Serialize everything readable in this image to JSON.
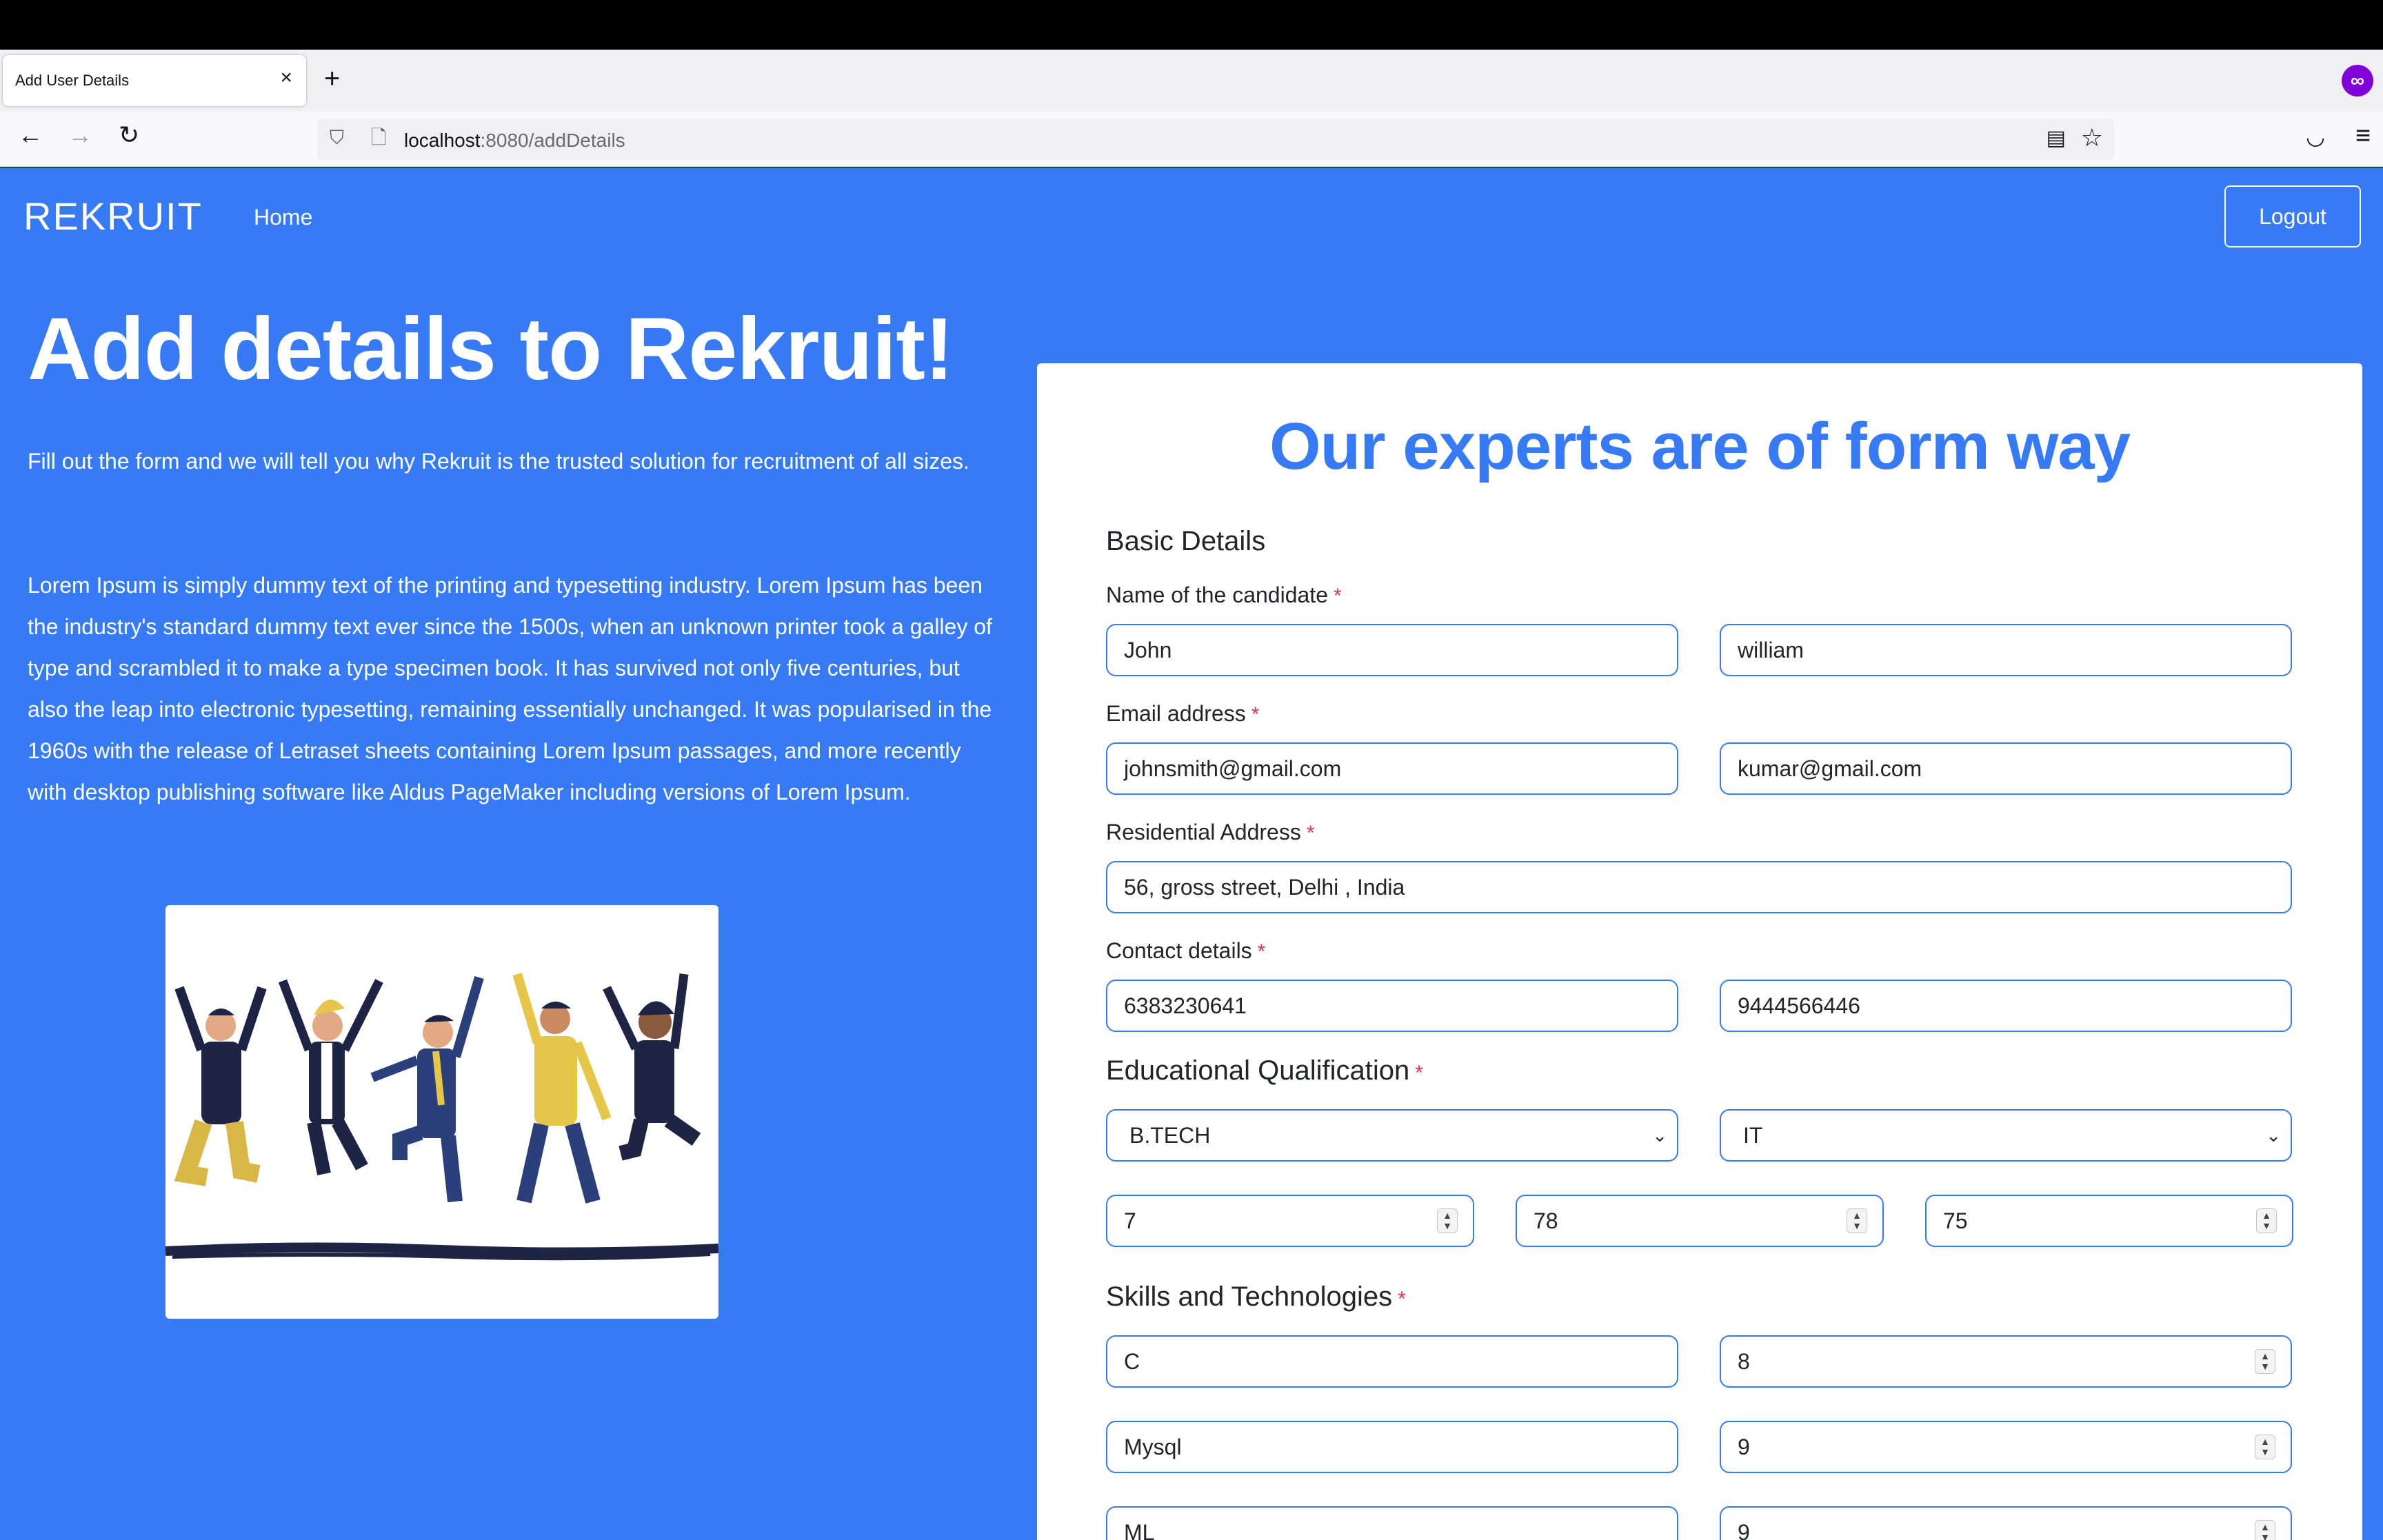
{
  "browser": {
    "tab_title": "Add User Details",
    "tab_close": "×",
    "new_tab": "+",
    "url_host": "localhost",
    "url_rest": ":8080/addDetails"
  },
  "header": {
    "brand": "REKRUIT",
    "nav_home": "Home",
    "logout": "Logout"
  },
  "hero": {
    "title": "Add details to Rekruit!",
    "lead": "Fill out the form and we will tell you why Rekruit is the trusted solution for recruitment of all sizes.",
    "body": "Lorem Ipsum is simply dummy text of the printing and typesetting industry. Lorem Ipsum has been the industry's standard dummy text ever since the 1500s, when an unknown printer took a galley of type and scrambled it to make a type specimen book. It has survived not only five centuries, but also the leap into electronic typesetting, remaining essentially unchanged. It was popularised in the 1960s with the release of Letraset sheets containing Lorem Ipsum passages, and more recently with desktop publishing software like Aldus PageMaker including versions of Lorem Ipsum."
  },
  "form": {
    "title": "Our experts are of form way",
    "required_mark": "*",
    "basic_details": "Basic Details",
    "name_label": "Name of the candidate",
    "first_name": "John",
    "last_name": "william",
    "email_label": "Email address",
    "email_primary": "johnsmith@gmail.com",
    "email_secondary": "kumar@gmail.com",
    "address_label": "Residential Address",
    "address": "56, gross street, Delhi , India",
    "contact_label": "Contact details",
    "phone_primary": "6383230641",
    "phone_secondary": "9444566446",
    "education_title": "Educational Qualification",
    "degree": "B.TECH",
    "branch": "IT",
    "edu_value_1": "7",
    "edu_value_2": "78",
    "edu_value_3": "75",
    "skills_title": "Skills and Technologies",
    "skills": [
      {
        "name": "C",
        "rating": "8"
      },
      {
        "name": "Mysql",
        "rating": "9"
      },
      {
        "name": "ML",
        "rating": "9"
      }
    ]
  },
  "colors": {
    "page_bg": "#377af5",
    "accent": "#377af5",
    "required": "#dc3545"
  }
}
